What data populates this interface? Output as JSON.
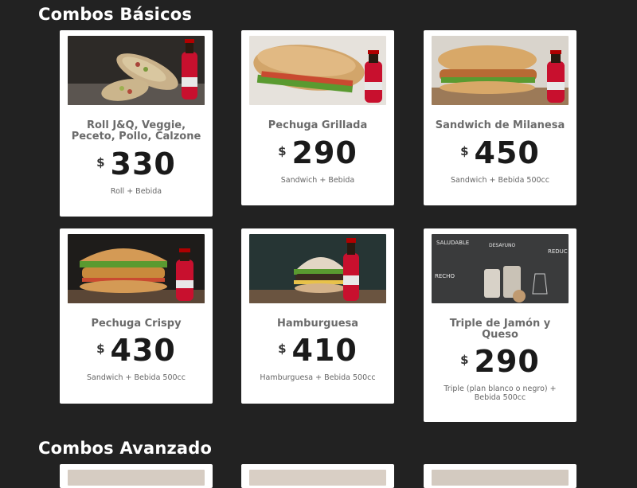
{
  "sections": {
    "basic_title": "Combos Básicos",
    "advanced_title": "Combos Avanzado"
  },
  "combos": [
    {
      "name": "Roll J&Q, Veggie, Peceto, Pollo, Calzone",
      "currency": "$",
      "price": "330",
      "desc": "Roll + Bebida"
    },
    {
      "name": "Pechuga Grillada",
      "currency": "$",
      "price": "290",
      "desc": "Sandwich + Bebida"
    },
    {
      "name": "Sandwich de Milanesa",
      "currency": "$",
      "price": "450",
      "desc": "Sandwich + Bebida 500cc"
    },
    {
      "name": "Pechuga Crispy",
      "currency": "$",
      "price": "430",
      "desc": "Sandwich + Bebida 500cc"
    },
    {
      "name": "Hamburguesa",
      "currency": "$",
      "price": "410",
      "desc": "Hamburguesa + Bebida 500cc"
    },
    {
      "name": "Triple de Jamón y Queso",
      "currency": "$",
      "price": "290",
      "desc": "Triple (plan blanco o negro) + Bebida 500cc"
    }
  ],
  "bottle_label": "Coca-Cola",
  "chalkboard": {
    "lines": [
      "SALUDABLE",
      "DESAYUNO",
      "RECHO",
      "REDUC"
    ]
  },
  "colors": {
    "background": "#222222",
    "card": "#ffffff",
    "coke": "#c8102e"
  }
}
